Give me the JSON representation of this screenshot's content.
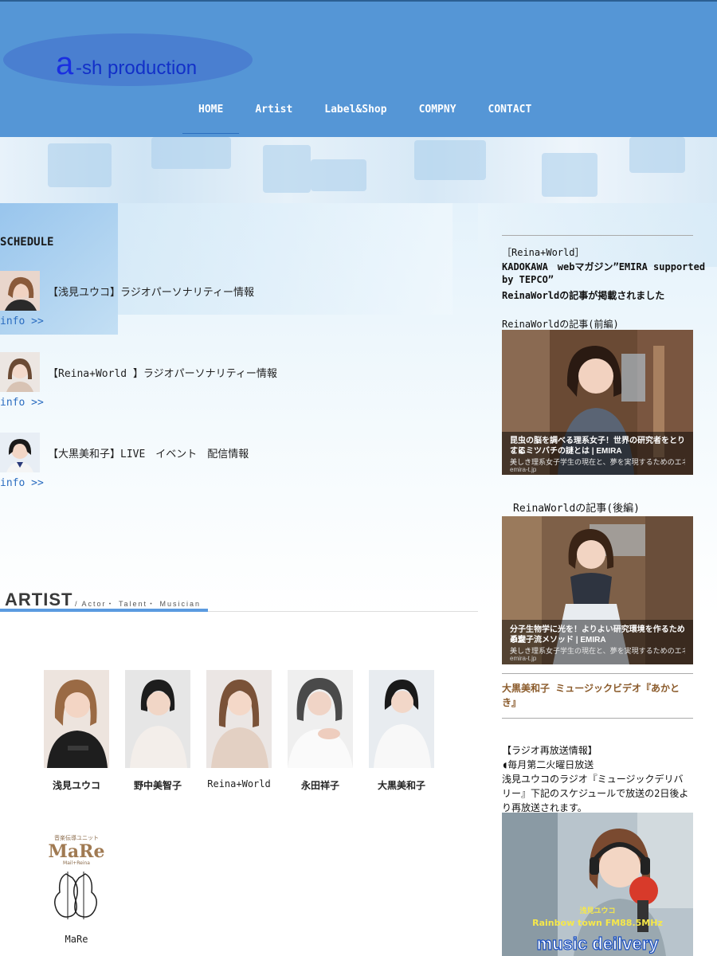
{
  "header": {
    "logo_a": "a",
    "logo_rest": "-sh production",
    "nav": [
      "HOME",
      "Artist",
      "Label&Shop",
      "COMPNY",
      "CONTACT"
    ],
    "active_nav": "HOME",
    "colors": {
      "header_bg": "#5596d6",
      "logo": "#1a2fe0",
      "accent": "#2b6fc0"
    }
  },
  "schedule": {
    "title": "SCHEDULE",
    "items": [
      {
        "text": "【浅見ユウコ】ラジオパーソナリティー情報",
        "link": "info >>"
      },
      {
        "text": "【Reina+World 】ラジオパーソナリティー情報",
        "link": "info >>"
      },
      {
        "text": "【大黒美和子】LIVE　イベント　配信情報",
        "link": "info >>"
      }
    ]
  },
  "artist": {
    "heading": "ARTIST",
    "sub": "/ Actor・ Talent・ Musician",
    "members": [
      {
        "name": "浅見ユウコ"
      },
      {
        "name": "野中美智子"
      },
      {
        "name": "Reina+World"
      },
      {
        "name": "永田祥子"
      },
      {
        "name": "大黒美和子"
      },
      {
        "name": "MaRe",
        "logo_small": "音楽伝導ユニット",
        "logo_big": "MaRe",
        "logo_sub": "Mail+Reina"
      }
    ]
  },
  "sidebar": {
    "reina_tag": "［Reina+World］",
    "kadokawa_1": "KADOKAWA　webマガジン”EMIRA supported",
    "kadokawa_2": "by TEPCO”",
    "kadokawa_3": "ReinaWorldの記事が掲載されました",
    "article1_label": "ReinaWorldの記事(前編)",
    "article1_title_1": "昆虫の脳を調べる理系女子！世界の研究者をとりこに",
    "article1_title_2": "するミツバチの謎とは | EMIRA",
    "article1_sub": "美しき理系女子学生の現在と、夢を実現するためのエネルギー...",
    "article1_src": "emira-t.jp",
    "article2_label": "ReinaWorldの記事(後編)",
    "article2_title_1": "分子生物学に光を！よりよい研究環境を作るための理",
    "article2_title_2": "系女子流メソッド | EMIRA",
    "article2_sub": "美しき理系女子学生の現在と、夢を実現するためのエネルギー...",
    "article2_src": "emira-t.jp",
    "mv_link_1": "大黒美和子 ミュージックビデオ『あかと",
    "mv_link_2": "き』",
    "radio_1": "【ラジオ再放送情報】",
    "radio_2": "◖毎月第二火曜日放送",
    "radio_3": "浅見ユウコのラジオ『ミュージックデリバ",
    "radio_4": "リー』下記のスケジュールで放送の2日後よ",
    "radio_5": "り再放送されます。",
    "radio_img_name": "浅見ユウコ",
    "radio_img_station": "Rainbow town FM88.5MHz",
    "radio_img_title": "music deilvery"
  }
}
